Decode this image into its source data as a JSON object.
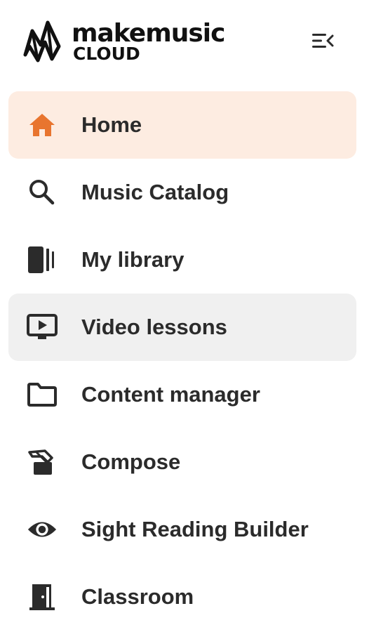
{
  "brand": {
    "name": "makemusic",
    "sub": "CLOUD"
  },
  "header": {
    "collapse_icon": "collapse-sidebar-icon"
  },
  "colors": {
    "accent": "#e8752f",
    "active_bg": "#fdece1",
    "hover_bg": "#f0f0f0",
    "text": "#2b2b2b"
  },
  "nav": {
    "items": [
      {
        "label": "Home",
        "icon": "home-icon",
        "state": "active"
      },
      {
        "label": "Music Catalog",
        "icon": "search-icon",
        "state": "normal"
      },
      {
        "label": "My library",
        "icon": "library-icon",
        "state": "normal"
      },
      {
        "label": "Video lessons",
        "icon": "video-icon",
        "state": "hover"
      },
      {
        "label": "Content manager",
        "icon": "folder-icon",
        "state": "normal"
      },
      {
        "label": "Compose",
        "icon": "compose-icon",
        "state": "normal"
      },
      {
        "label": "Sight Reading Builder",
        "icon": "eye-icon",
        "state": "normal"
      },
      {
        "label": "Classroom",
        "icon": "classroom-door-icon",
        "state": "normal"
      }
    ]
  }
}
